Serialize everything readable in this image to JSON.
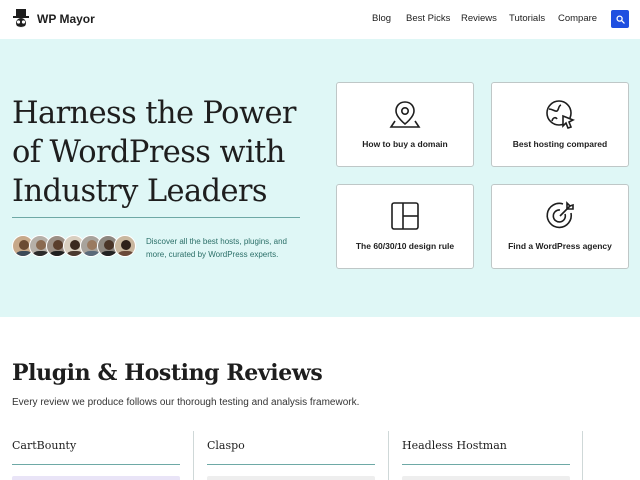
{
  "header": {
    "brand": "WP Mayor",
    "nav": [
      {
        "label": "Blog"
      },
      {
        "label": "Best Picks"
      },
      {
        "label": "Reviews"
      },
      {
        "label": "Tutorials"
      },
      {
        "label": "Compare"
      }
    ],
    "search_icon": "search-icon"
  },
  "hero": {
    "title": "Harness the Power of WordPress with Industry Leaders",
    "description": "Discover all the best hosts, plugins, and more, curated by WordPress experts.",
    "cards": [
      {
        "label": "How to buy a domain",
        "icon": "location-pin-icon"
      },
      {
        "label": "Best hosting compared",
        "icon": "globe-cursor-icon"
      },
      {
        "label": "The 60/30/10 design rule",
        "icon": "layout-grid-icon"
      },
      {
        "label": "Find a WordPress agency",
        "icon": "target-icon"
      }
    ]
  },
  "reviews": {
    "title": "Plugin & Hosting Reviews",
    "subtitle": "Every review we produce follows our thorough testing and analysis framework.",
    "items": [
      {
        "name": "CartBounty"
      },
      {
        "name": "Claspo"
      },
      {
        "name": "Headless Hostman"
      }
    ]
  },
  "colors": {
    "hero_bg": "#dff7f6",
    "accent_blue": "#1f4fe0",
    "teal_text": "#2b6f68"
  }
}
